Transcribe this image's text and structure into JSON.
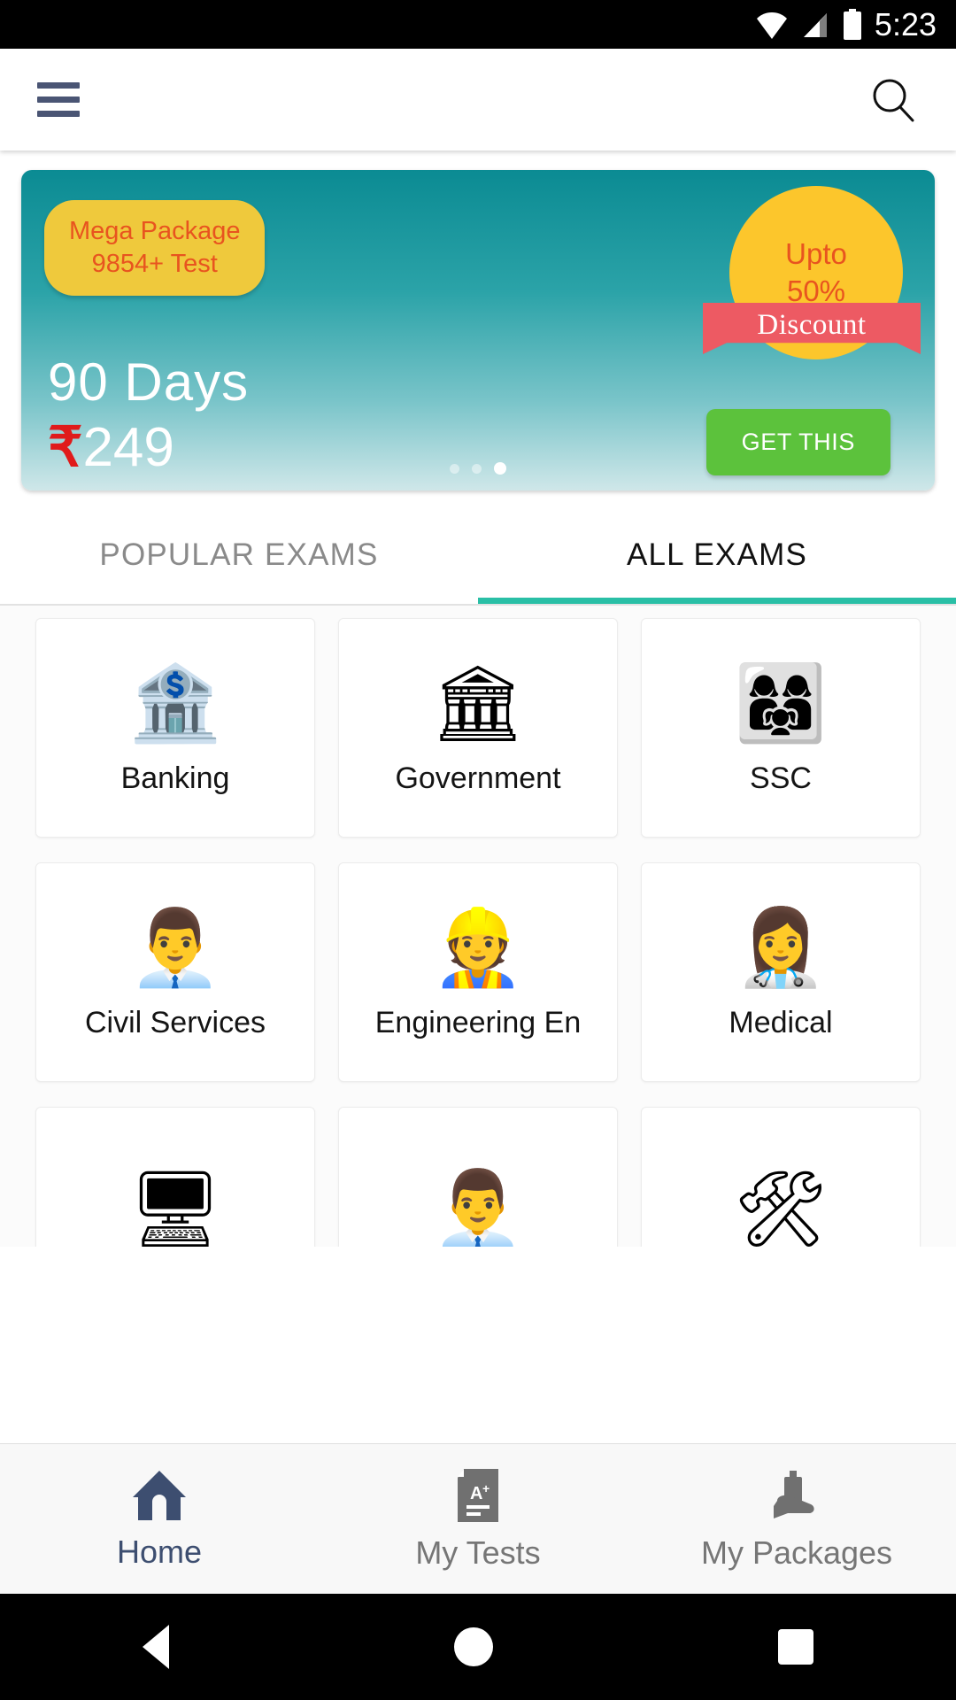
{
  "statusbar": {
    "time": "5:23",
    "icons": [
      "wifi-icon",
      "cellular-signal-icon",
      "battery-icon"
    ]
  },
  "appbar": {
    "menu_icon": "hamburger-menu-icon",
    "search_icon": "search-icon"
  },
  "banner": {
    "package_title": "Mega Package",
    "package_subtitle": "9854+ Test",
    "duration": "90  Days",
    "currency_symbol": "₹",
    "price": "249",
    "discount_upto": "Upto",
    "discount_value": "50%",
    "discount_ribbon": "Discount",
    "cta_label": "GET THIS",
    "dots_total": 3,
    "dot_active_index": 2,
    "colors": {
      "gradient_top": "#0b8b93",
      "gradient_bottom": "#cfe7e9",
      "pill_bg": "#efc93c",
      "pill_text": "#e8541f",
      "circle_bg": "#fcc62c",
      "ribbon_bg": "#ed5a63",
      "cta_bg": "#5cc23c",
      "rupee_color": "#e01b1b"
    }
  },
  "tabs": [
    {
      "label": "POPULAR EXAMS",
      "active": false
    },
    {
      "label": "ALL EXAMS",
      "active": true
    }
  ],
  "tab_accent_color": "#29bfa6",
  "exam_cards": [
    {
      "label": "Banking",
      "icon": "bank-building-icon",
      "glyph": "🏦"
    },
    {
      "label": "Government",
      "icon": "government-building-icon",
      "glyph": "🏛"
    },
    {
      "label": "SSC",
      "icon": "group-of-people-icon",
      "glyph": "👩‍👩‍👧"
    },
    {
      "label": "Civil Services",
      "icon": "officer-podium-icon",
      "glyph": "👨‍💼"
    },
    {
      "label": "Engineering En",
      "icon": "construction-worker-icon",
      "glyph": "👷"
    },
    {
      "label": "Medical",
      "icon": "doctor-icon",
      "glyph": "👩‍⚕️"
    },
    {
      "label": "",
      "icon": "computer-monitor-icon",
      "glyph": "🖥"
    },
    {
      "label": "",
      "icon": "businessman-briefcase-icon",
      "glyph": "👨‍💼"
    },
    {
      "label": "",
      "icon": "hammer-and-wrench-icon",
      "glyph": "🛠"
    }
  ],
  "bottom_nav": [
    {
      "label": "Home",
      "icon": "home-icon",
      "active": true
    },
    {
      "label": "My Tests",
      "icon": "test-paper-icon",
      "active": false
    },
    {
      "label": "My Packages",
      "icon": "package-in-hand-icon",
      "active": false
    }
  ],
  "system_nav": {
    "back": "back-triangle-icon",
    "home": "home-circle-icon",
    "recents": "recents-square-icon"
  }
}
